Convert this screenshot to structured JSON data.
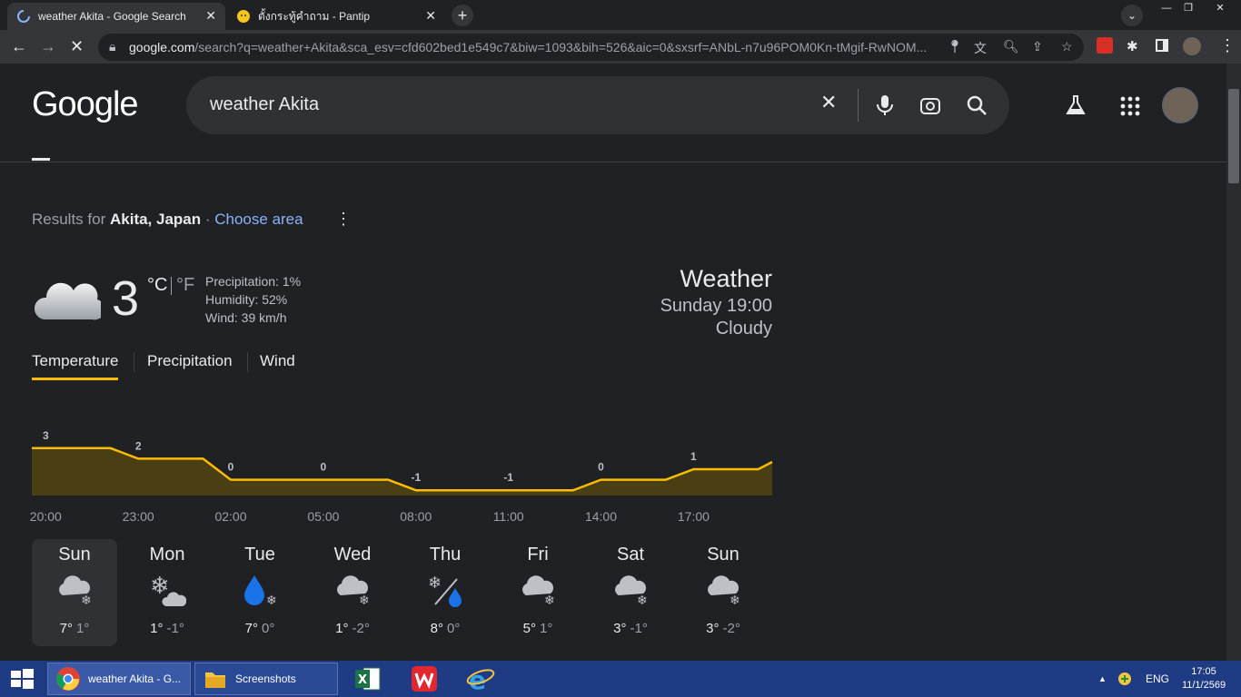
{
  "browser": {
    "tabs": [
      {
        "title": "weather Akita - Google Search",
        "icon": "loading-spinner-icon"
      },
      {
        "title": "ตั้งกระทู้คำถาม - Pantip",
        "icon": "pantip-icon"
      }
    ],
    "new_tab_label": "+",
    "url_host": "google.com",
    "url_rest": "/search?q=weather+Akita&sca_esv=cfd602bed1e549c7&biw=1093&bih=526&aic=0&sxsrf=ANbL-n7u96POM0Kn-tMgif-RwNOM..."
  },
  "google": {
    "logo": "Google",
    "query": "weather Akita"
  },
  "weather": {
    "results_for_prefix": "Results for ",
    "location": "Akita, Japan",
    "separator": " · ",
    "choose_area": "Choose area",
    "current_temp": "3",
    "unit_c": "°C",
    "unit_f": "°F",
    "precipitation": "Precipitation: 1%",
    "humidity": "Humidity: 52%",
    "wind": "Wind: 39 km/h",
    "title": "Weather",
    "time": "Sunday 19:00",
    "condition": "Cloudy",
    "tabs": [
      "Temperature",
      "Precipitation",
      "Wind"
    ],
    "days": [
      {
        "name": "Sun",
        "high": "7°",
        "low": "1°",
        "icon": "cloud-snow-icon"
      },
      {
        "name": "Mon",
        "high": "1°",
        "low": "-1°",
        "icon": "snow-cloud-icon"
      },
      {
        "name": "Tue",
        "high": "7°",
        "low": "0°",
        "icon": "rain-snow-icon"
      },
      {
        "name": "Wed",
        "high": "1°",
        "low": "-2°",
        "icon": "cloud-snow-icon"
      },
      {
        "name": "Thu",
        "high": "8°",
        "low": "0°",
        "icon": "snow-rain-icon"
      },
      {
        "name": "Fri",
        "high": "5°",
        "low": "1°",
        "icon": "cloud-snow-icon"
      },
      {
        "name": "Sat",
        "high": "3°",
        "low": "-1°",
        "icon": "cloud-snow-icon"
      },
      {
        "name": "Sun",
        "high": "3°",
        "low": "-2°",
        "icon": "cloud-snow-icon"
      }
    ]
  },
  "chart_data": {
    "type": "area",
    "x": [
      "20:00",
      "23:00",
      "02:00",
      "05:00",
      "08:00",
      "11:00",
      "14:00",
      "17:00"
    ],
    "labels": [
      "3",
      "2",
      "0",
      "0",
      "-1",
      "-1",
      "0",
      "1"
    ],
    "values": [
      3,
      2,
      0,
      0,
      -1,
      -1,
      0,
      1
    ],
    "ylim": [
      -1.5,
      3.5
    ],
    "color": "#fbbc04",
    "fill": "#4a3f12"
  },
  "taskbar": {
    "items": [
      {
        "label": "weather Akita - G...",
        "icon": "chrome-icon"
      },
      {
        "label": "Screenshots",
        "icon": "folder-icon"
      }
    ],
    "pinned": [
      "excel-icon",
      "wps-icon",
      "ie-icon"
    ],
    "lang": "ENG",
    "time": "17:05",
    "date": "11/1/2569"
  },
  "colors": {
    "accent": "#fbbc04",
    "link": "#8ab4f8",
    "bg": "#202124"
  }
}
